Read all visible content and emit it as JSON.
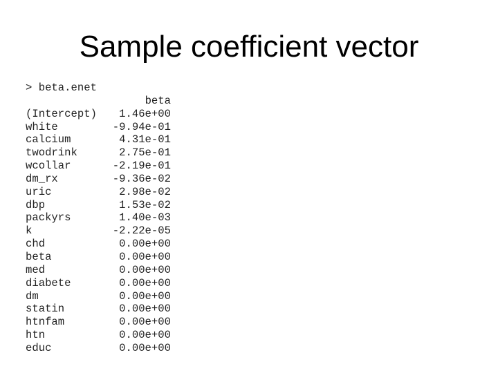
{
  "slide": {
    "title": "Sample coefficient vector"
  },
  "console": {
    "command": "> beta.enet",
    "column_header": "beta",
    "rows": [
      {
        "name": "(Intercept)",
        "value": "1.46e+00"
      },
      {
        "name": "white",
        "value": "-9.94e-01"
      },
      {
        "name": "calcium",
        "value": "4.31e-01"
      },
      {
        "name": "twodrink",
        "value": "2.75e-01"
      },
      {
        "name": "wcollar",
        "value": "-2.19e-01"
      },
      {
        "name": "dm_rx",
        "value": "-9.36e-02"
      },
      {
        "name": "uric",
        "value": "2.98e-02"
      },
      {
        "name": "dbp",
        "value": "1.53e-02"
      },
      {
        "name": "packyrs",
        "value": "1.40e-03"
      },
      {
        "name": "k",
        "value": "-2.22e-05"
      },
      {
        "name": "chd",
        "value": "0.00e+00"
      },
      {
        "name": "beta",
        "value": "0.00e+00"
      },
      {
        "name": "med",
        "value": "0.00e+00"
      },
      {
        "name": "diabete",
        "value": "0.00e+00"
      },
      {
        "name": "dm",
        "value": "0.00e+00"
      },
      {
        "name": "statin",
        "value": "0.00e+00"
      },
      {
        "name": "htnfam",
        "value": "0.00e+00"
      },
      {
        "name": "htn",
        "value": "0.00e+00"
      },
      {
        "name": "educ",
        "value": "0.00e+00"
      }
    ]
  }
}
